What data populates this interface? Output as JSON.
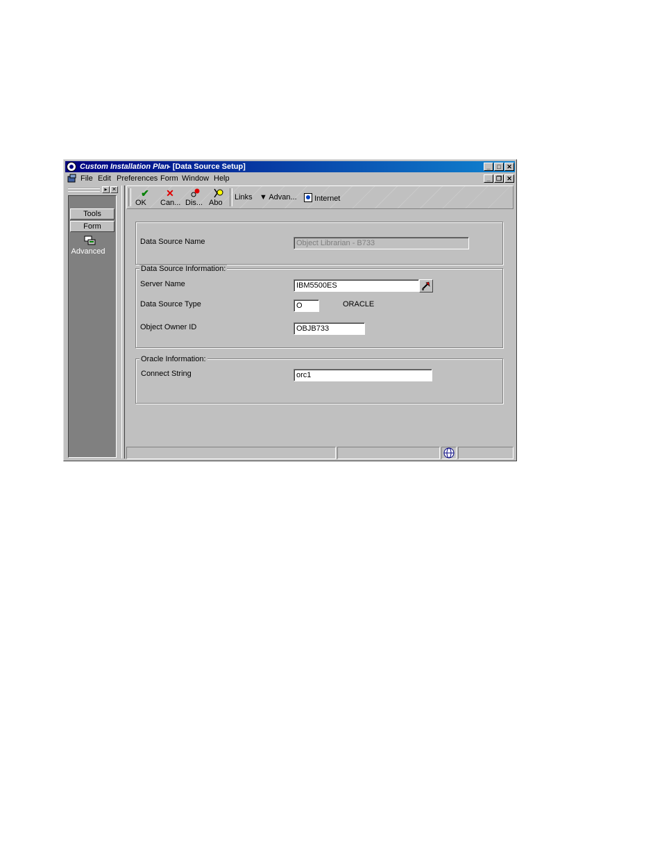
{
  "window": {
    "title_app": "Custom Installation Plan",
    "title_form": " - [Data Source Setup]"
  },
  "menubar": {
    "items": [
      "File",
      "Edit",
      "Preferences",
      "Form",
      "Window",
      "Help"
    ]
  },
  "sidebar": {
    "tabs": [
      "Tools",
      "Form"
    ],
    "advanced_label": "Advanced"
  },
  "toolbar": {
    "buttons": [
      {
        "label": "OK",
        "icon": "check-icon"
      },
      {
        "label": "Can...",
        "icon": "cancel-x-icon"
      },
      {
        "label": "Dis...",
        "icon": "display-icon"
      },
      {
        "label": "Abo",
        "icon": "about-icon"
      }
    ],
    "links": "Links",
    "advanced": "Advan...",
    "internet": "Internet"
  },
  "form": {
    "data_source_name_label": "Data Source Name",
    "data_source_name_value": "Object Librarian - B733",
    "group_info_title": "Data Source Information:",
    "server_name_label": "Server Name",
    "server_name_value": "IBM5500ES",
    "data_source_type_label": "Data Source Type",
    "data_source_type_value": "O",
    "data_source_type_desc": "ORACLE",
    "object_owner_label": "Object Owner ID",
    "object_owner_value": "OBJB733",
    "group_oracle_title": "Oracle Information:",
    "connect_string_label": "Connect String",
    "connect_string_value": "orc1"
  },
  "colors": {
    "title_bar": "#000080",
    "face": "#c0c0c0",
    "sidebar_panel": "#808080"
  }
}
